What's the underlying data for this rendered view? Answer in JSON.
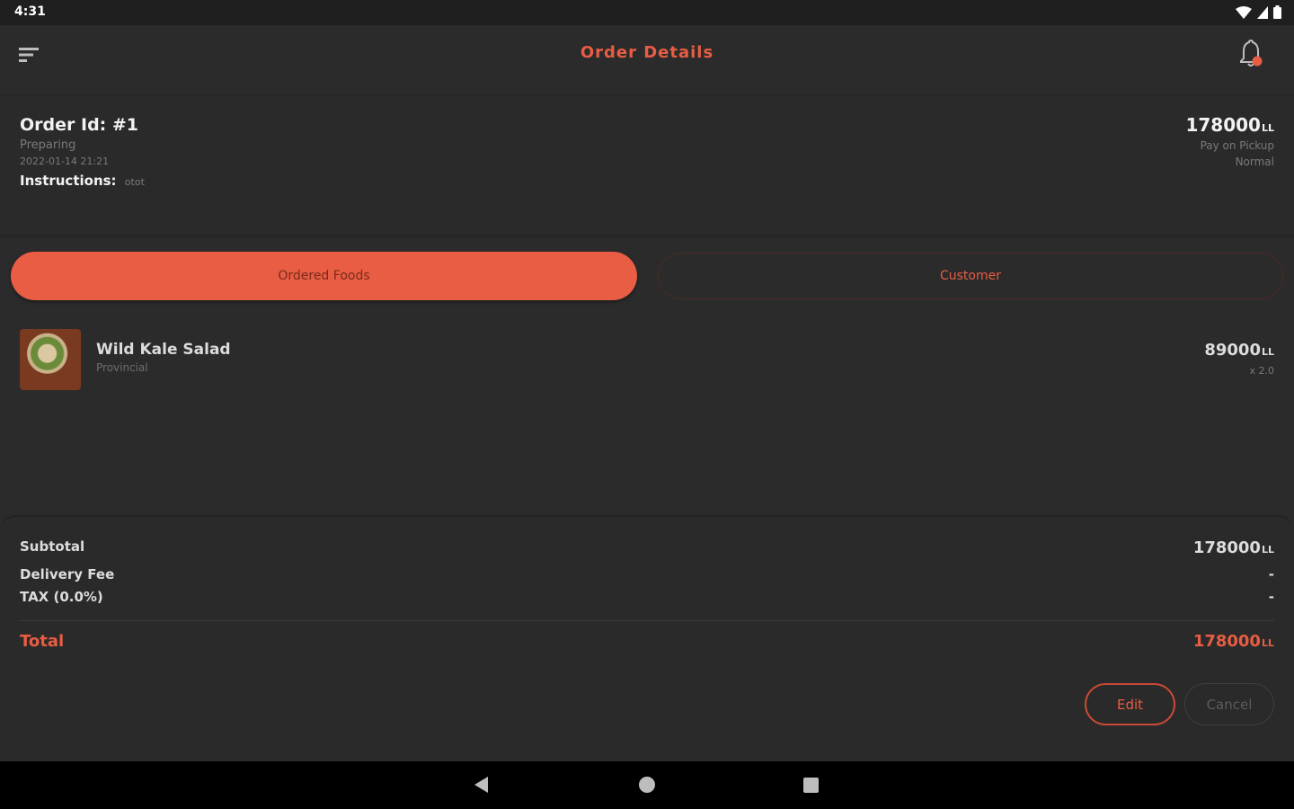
{
  "status_bar": {
    "time": "4:31",
    "icons": [
      "wifi-icon",
      "signal-icon",
      "battery-icon"
    ]
  },
  "app_bar": {
    "title": "Order Details",
    "menu_icon": "sort-menu-icon",
    "notification_icon": "bell-icon"
  },
  "order": {
    "id_label": "Order Id: #1",
    "status": "Preparing",
    "date": "2022-01-14 21:21",
    "instructions_label": "Instructions:",
    "instructions_value": "otot",
    "amount": "178000",
    "currency": "LL",
    "payment_method": "Pay on Pickup",
    "payment_status": "Normal"
  },
  "tabs": [
    {
      "label": "Ordered Foods",
      "active": true
    },
    {
      "label": "Customer",
      "active": false
    }
  ],
  "food_items": [
    {
      "name": "Wild Kale Salad",
      "restaurant": "Provincial",
      "price": "89000",
      "currency": "LL",
      "quantity": "x 2.0"
    }
  ],
  "summary": {
    "subtotal_label": "Subtotal",
    "subtotal_value": "178000",
    "delivery_label": "Delivery Fee",
    "delivery_value": "-",
    "tax_label": "TAX (0.0%)",
    "tax_value": "-",
    "total_label": "Total",
    "total_value": "178000",
    "currency": "LL"
  },
  "actions": {
    "edit_label": "Edit",
    "cancel_label": "Cancel"
  },
  "colors": {
    "accent": "#e85d43",
    "background": "#2b2b2b",
    "muted_text": "#7a7a7a"
  }
}
